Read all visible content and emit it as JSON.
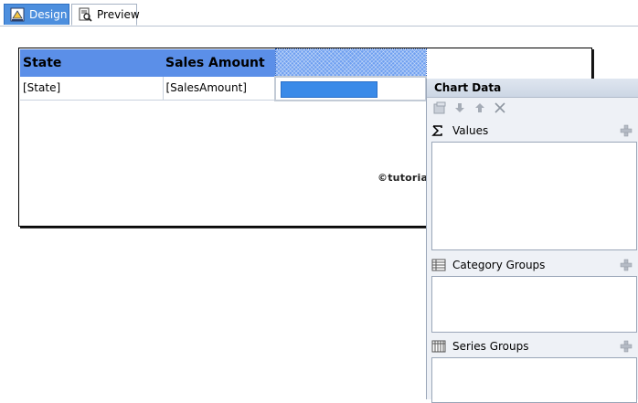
{
  "tabs": {
    "design_label": "Design",
    "preview_label": "Preview"
  },
  "report": {
    "headers": [
      "State",
      "Sales Amount",
      ""
    ],
    "detail": [
      "[State]",
      "[SalesAmount]"
    ],
    "watermark": "©tutorialgateway.org"
  },
  "chart_data_pane": {
    "title": "Chart Data",
    "toolbar_icons": [
      "properties-icon",
      "move-down-icon",
      "move-up-icon",
      "delete-icon"
    ],
    "sections": [
      {
        "label": "Values",
        "icon": "sigma-icon"
      },
      {
        "label": "Category Groups",
        "icon": "list-icon"
      },
      {
        "label": "Series Groups",
        "icon": "columns-icon"
      }
    ]
  },
  "colors": {
    "header_bg": "#5b8fe8",
    "tab_active": "#4d8fde",
    "sparkline_bar": "#3a8ae8"
  }
}
